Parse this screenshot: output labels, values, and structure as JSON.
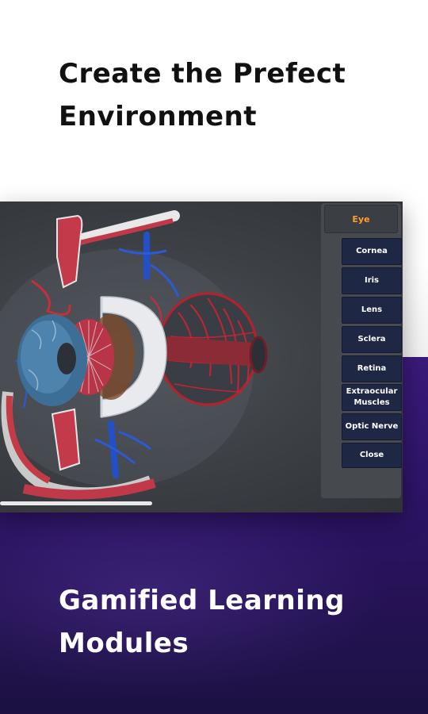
{
  "headlines": {
    "top": "Create the Prefect Environment",
    "bottom": "Gamified Learning Modules"
  },
  "viewer": {
    "panel_title": "Eye",
    "buttons": [
      "Cornea",
      "Iris",
      "Lens",
      "Sclera",
      "Retina",
      "Extraocular Muscles",
      "Optic Nerve",
      "Close"
    ]
  },
  "colors": {
    "panel_title": "#ff9d2e",
    "button_bg": "#1e2844",
    "bottom_bg": "#2c1466"
  }
}
